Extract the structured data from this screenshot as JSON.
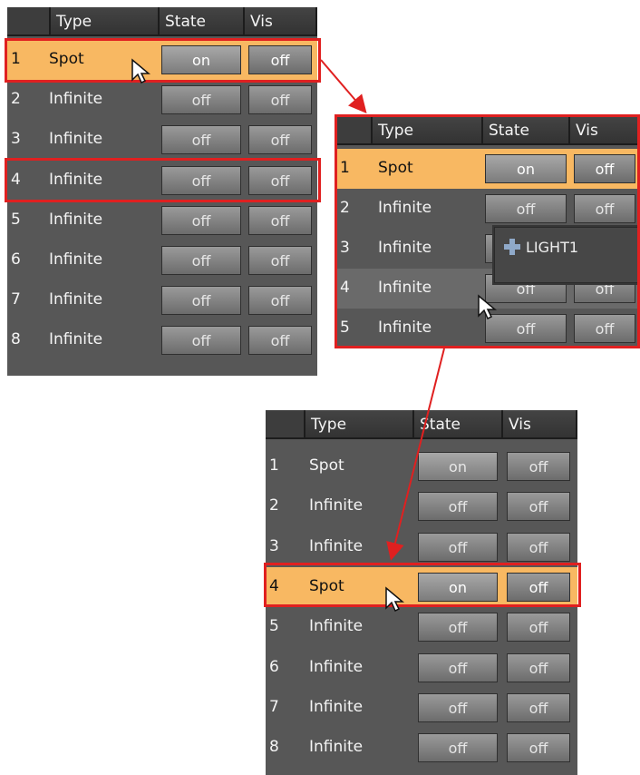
{
  "headers": {
    "type": "Type",
    "state": "State",
    "vis": "Vis"
  },
  "panel_before": {
    "rows": [
      {
        "num": "1",
        "type": "Spot",
        "state": "on",
        "vis": "off",
        "selected": true
      },
      {
        "num": "2",
        "type": "Infinite",
        "state": "off",
        "vis": "off"
      },
      {
        "num": "3",
        "type": "Infinite",
        "state": "off",
        "vis": "off"
      },
      {
        "num": "4",
        "type": "Infinite",
        "state": "off",
        "vis": "off"
      },
      {
        "num": "5",
        "type": "Infinite",
        "state": "off",
        "vis": "off"
      },
      {
        "num": "6",
        "type": "Infinite",
        "state": "off",
        "vis": "off"
      },
      {
        "num": "7",
        "type": "Infinite",
        "state": "off",
        "vis": "off"
      },
      {
        "num": "8",
        "type": "Infinite",
        "state": "off",
        "vis": "off"
      }
    ]
  },
  "panel_drag": {
    "rows": [
      {
        "num": "1",
        "type": "Spot",
        "state": "on",
        "vis": "off",
        "selected": true
      },
      {
        "num": "2",
        "type": "Infinite",
        "state": "off",
        "vis": "off"
      },
      {
        "num": "3",
        "type": "Infinite",
        "state": "off",
        "vis": "off"
      },
      {
        "num": "4",
        "type": "Infinite",
        "state": "off",
        "vis": "off",
        "hover": true
      },
      {
        "num": "5",
        "type": "Infinite",
        "state": "off",
        "vis": "off"
      }
    ],
    "drag_label": "LIGHT1"
  },
  "panel_after": {
    "rows": [
      {
        "num": "1",
        "type": "Spot",
        "state": "on",
        "vis": "off"
      },
      {
        "num": "2",
        "type": "Infinite",
        "state": "off",
        "vis": "off"
      },
      {
        "num": "3",
        "type": "Infinite",
        "state": "off",
        "vis": "off"
      },
      {
        "num": "4",
        "type": "Spot",
        "state": "on",
        "vis": "off",
        "selected": true
      },
      {
        "num": "5",
        "type": "Infinite",
        "state": "off",
        "vis": "off"
      },
      {
        "num": "6",
        "type": "Infinite",
        "state": "off",
        "vis": "off"
      },
      {
        "num": "7",
        "type": "Infinite",
        "state": "off",
        "vis": "off"
      },
      {
        "num": "8",
        "type": "Infinite",
        "state": "off",
        "vis": "off"
      }
    ]
  },
  "colors": {
    "highlight": "#e02020",
    "selected_row": "#f8b862",
    "panel": "#575757"
  }
}
